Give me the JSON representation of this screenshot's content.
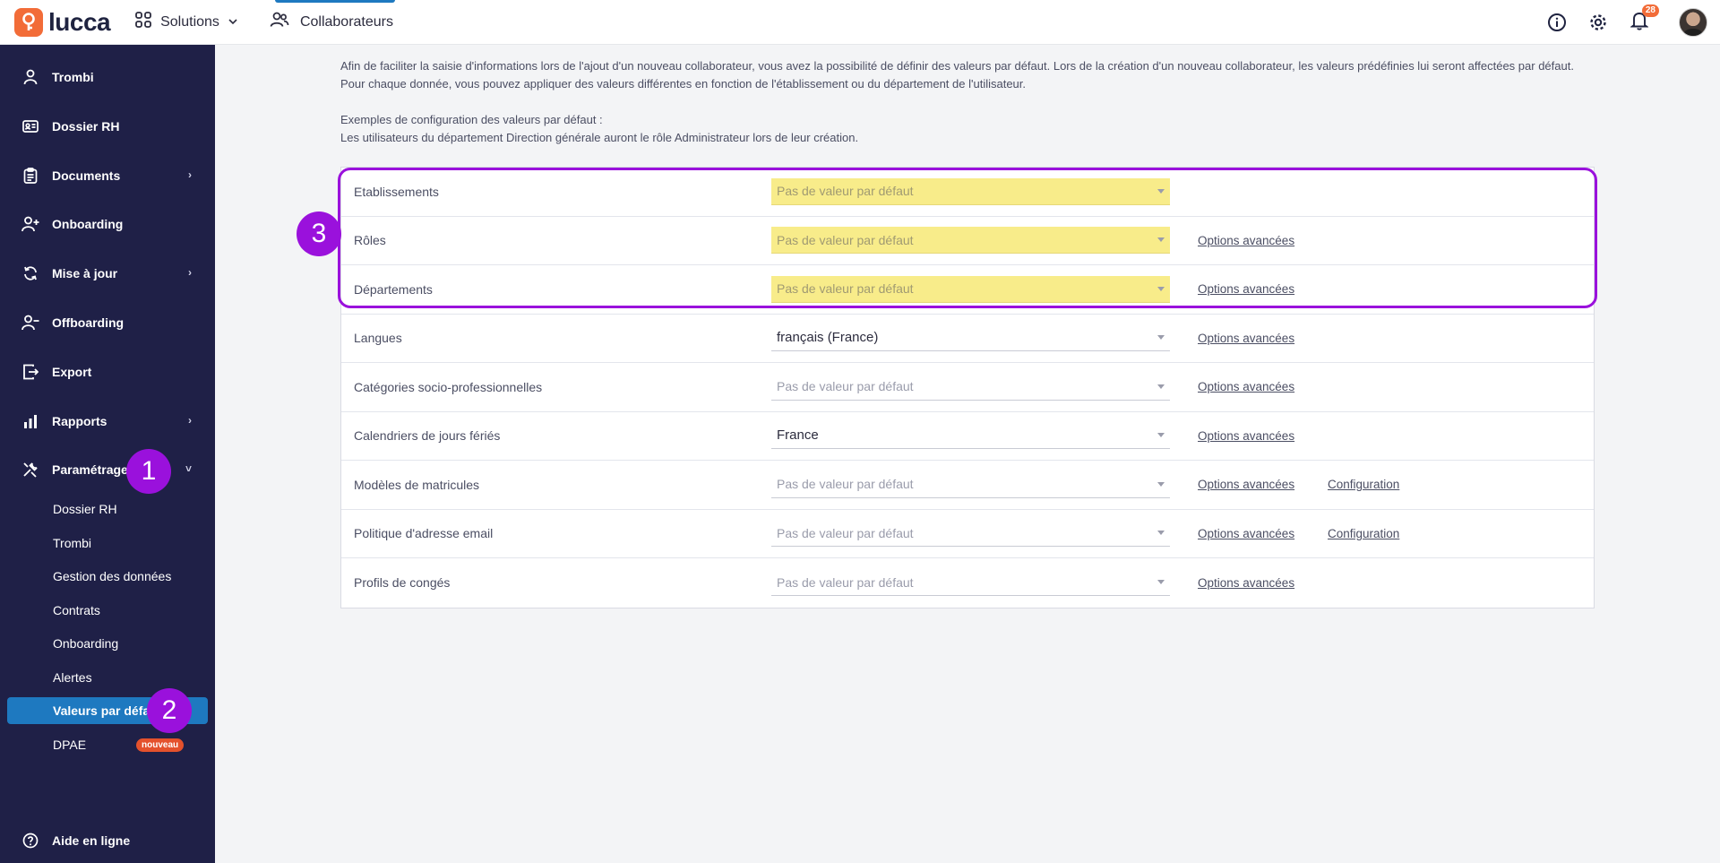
{
  "topbar": {
    "logo_text": "lucca",
    "solutions_label": "Solutions",
    "collaborateurs_label": "Collaborateurs",
    "notification_count": "28"
  },
  "sidebar": {
    "items": [
      {
        "label": "Trombi",
        "icon": "person-icon"
      },
      {
        "label": "Dossier RH",
        "icon": "id-card-icon"
      },
      {
        "label": "Documents",
        "icon": "clipboard-icon"
      },
      {
        "label": "Onboarding",
        "icon": "person-add-icon"
      },
      {
        "label": "Mise à jour",
        "icon": "refresh-icon"
      },
      {
        "label": "Offboarding",
        "icon": "person-remove-icon"
      },
      {
        "label": "Export",
        "icon": "export-icon"
      },
      {
        "label": "Rapports",
        "icon": "bar-chart-icon"
      },
      {
        "label": "Paramétrage",
        "icon": "tools-icon"
      }
    ],
    "sub_items": [
      {
        "label": "Dossier RH"
      },
      {
        "label": "Trombi"
      },
      {
        "label": "Gestion des données"
      },
      {
        "label": "Contrats"
      },
      {
        "label": "Onboarding"
      },
      {
        "label": "Alertes"
      },
      {
        "label": "Valeurs par défaut"
      },
      {
        "label": "DPAE",
        "badge": "nouveau"
      }
    ],
    "help_label": "Aide en ligne"
  },
  "markers": [
    "1",
    "2",
    "3"
  ],
  "intro": {
    "line1": "Afin de faciliter la saisie d'informations lors de l'ajout d'un nouveau collaborateur, vous avez la possibilité de définir des valeurs par défaut. Lors de la création d'un nouveau collaborateur, les valeurs prédéfinies lui seront affectées par défaut.",
    "line2": "Pour chaque donnée, vous pouvez appliquer des valeurs différentes en fonction de l'établissement ou du département de l'utilisateur.",
    "line3": "Exemples de configuration des valeurs par défaut :",
    "line4": "Les utilisateurs du département Direction générale auront le rôle Administrateur lors de leur création."
  },
  "rows": [
    {
      "label": "Etablissements",
      "value": "Pas de valeur par défaut",
      "options": ""
    },
    {
      "label": "Rôles",
      "value": "Pas de valeur par défaut",
      "options": "Options avancées"
    },
    {
      "label": "Départements",
      "value": "Pas de valeur par défaut",
      "options": "Options avancées"
    },
    {
      "label": "Langues",
      "value": "français (France)",
      "options": "Options avancées"
    },
    {
      "label": "Catégories socio-professionnelles",
      "value": "Pas de valeur par défaut",
      "options": "Options avancées"
    },
    {
      "label": "Calendriers de jours fériés",
      "value": "France",
      "options": "Options avancées"
    },
    {
      "label": "Modèles de matricules",
      "value": "Pas de valeur par défaut",
      "options": "Options avancées",
      "config": "Configuration"
    },
    {
      "label": "Politique d'adresse email",
      "value": "Pas de valeur par défaut",
      "options": "Options avancées",
      "config": "Configuration"
    },
    {
      "label": "Profils de congés",
      "value": "Pas de valeur par défaut",
      "options": "Options avancées"
    }
  ],
  "colors": {
    "sidebar_bg": "#1f2047",
    "active_item": "#1e79c0",
    "annotation": "#9a11dc",
    "highlight": "#f8ec8a",
    "brand": "#f26c38"
  }
}
